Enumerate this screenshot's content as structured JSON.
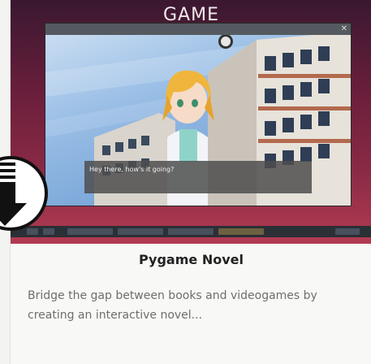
{
  "hero": {
    "title": "GAME",
    "dialog_text": "Hey there, how's it going?",
    "colors": {
      "background": "#7a2240",
      "dialog": "#4e4e4e"
    }
  },
  "icons": {
    "download": "download-arrow-icon"
  },
  "card": {
    "title": "Pygame Novel",
    "description": "Bridge the gap between books and videogames by creating an interactive novel..."
  }
}
